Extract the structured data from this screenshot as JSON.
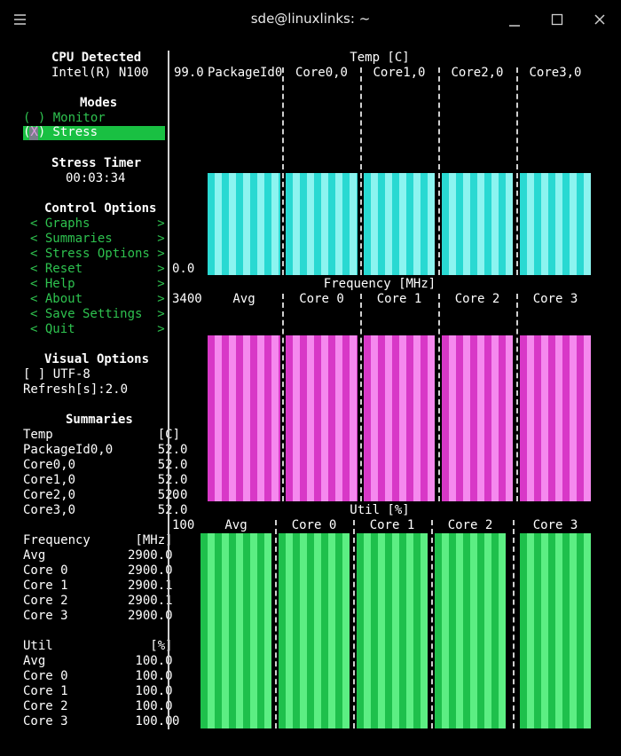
{
  "window": {
    "title": "sde@linuxlinks: ~"
  },
  "sidebar": {
    "cpu_heading": "CPU Detected",
    "cpu_name": "Intel(R) N100",
    "modes_heading": "Modes",
    "mode_monitor": "( ) Monitor",
    "mode_stress_mark": "(X)",
    "mode_stress_label": " Stress",
    "timer_heading": "Stress Timer",
    "timer_value": "00:03:34",
    "control_heading": "Control Options",
    "control_items": [
      "< Graphs         >",
      "< Summaries      >",
      "< Stress Options >",
      "< Reset          >",
      "< Help           >",
      "< About          >",
      "< Save Settings  >",
      "< Quit           >"
    ],
    "visual_heading": "Visual Options",
    "utf8_option": "[ ] UTF-8",
    "refresh_option": "Refresh[s]:2.0",
    "summaries_heading": "Summaries",
    "temp_header": "Temp              [C]",
    "temp_rows": [
      "PackageId0,0      52.0",
      "Core0,0           52.0",
      "Core1,0           52.0",
      "Core2,0           52.0",
      "Core3,0           52.0"
    ],
    "freq_header": "Frequency      [MHz]",
    "freq_rows": [
      "Avg           2900.0",
      "Core 0        2900.0",
      "Core 1        2900.1",
      "Core 2        2900.1",
      "Core 3        2900.0"
    ],
    "util_header": "Util             [%]",
    "util_rows": [
      "Avg            100.0",
      "Core 0         100.0",
      "Core 1         100.0",
      "Core 2         100.0",
      "Core 3         100.0"
    ]
  },
  "graphs": {
    "temp": {
      "title": "Temp [C]",
      "y_max": "99.0",
      "y_min": "0.0",
      "columns": [
        "PackageId0",
        "Core0,0",
        "Core1,0",
        "Core2,0",
        "Core3,0"
      ],
      "bar_level": 0.525,
      "color": "#29d9d2"
    },
    "freq": {
      "title": "Frequency [MHz]",
      "y_max": "3400",
      "y_min": "0",
      "columns": [
        "Avg",
        "Core 0",
        "Core 1",
        "Core 2",
        "Core 3"
      ],
      "bar_level": 0.853,
      "color": "#d838c7"
    },
    "util": {
      "title": "Util [%]",
      "y_max": "100",
      "y_min": "0",
      "columns": [
        "Avg",
        "Core 0",
        "Core 1",
        "Core 2",
        "Core 3"
      ],
      "bar_level": 1.0,
      "color": "#1ec04c"
    }
  }
}
